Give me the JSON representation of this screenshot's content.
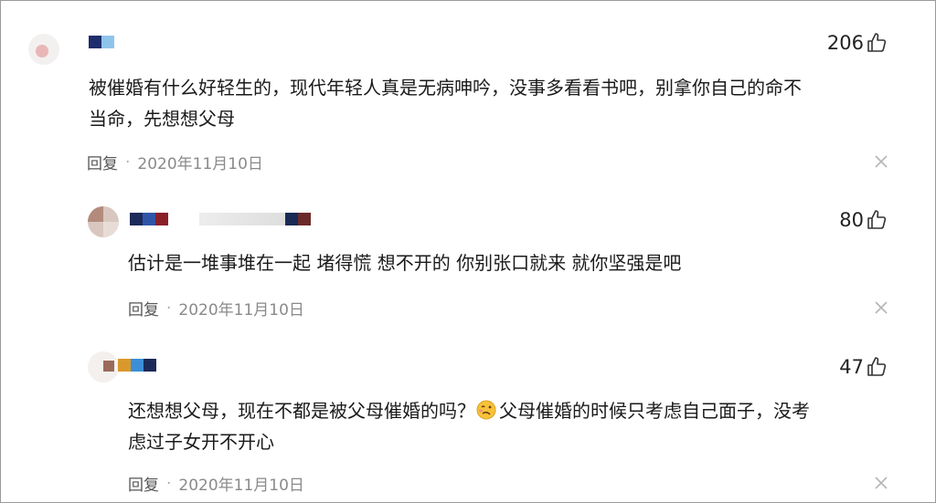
{
  "comments": [
    {
      "likes": "206",
      "text_lines": [
        "被催婚有什么好轻生的，现代年轻人真是无病呻吟，没事多看看书吧，别拿你自己的命不",
        "当命，先想想父母"
      ],
      "reply_label": "回复",
      "date": "2020年11月10日"
    },
    {
      "likes": "80",
      "text_lines": [
        "估计是一堆事堆在一起 堵得慌 想不开的 你别张口就来 就你坚强是吧"
      ],
      "reply_label": "回复",
      "date": "2020年11月10日"
    },
    {
      "likes": "47",
      "text_before_emoji": "还想想父母，现在不都是被父母催婚的吗？",
      "emoji": "woozy-face",
      "text_after_emoji": "父母催婚的时候只考虑自己面子，没考",
      "text_line2": "虑过子女开不开心",
      "reply_label": "回复",
      "date": "2020年11月10日"
    }
  ],
  "colors": {
    "text": "#1a1a1a",
    "meta": "#8a8a8a",
    "icon": "#333333"
  }
}
